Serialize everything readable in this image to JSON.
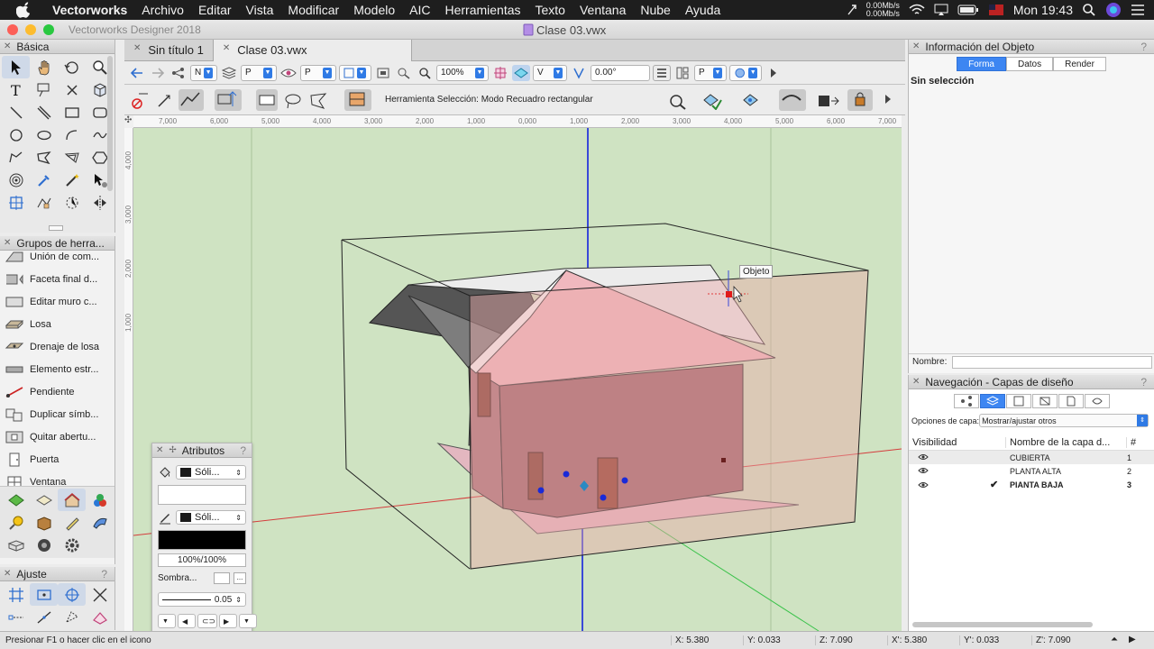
{
  "menubar": {
    "app_name": "Vectorworks",
    "items": [
      "Archivo",
      "Editar",
      "Vista",
      "Modificar",
      "Modelo",
      "AIC",
      "Herramientas",
      "Texto",
      "Ventana",
      "Nube",
      "Ayuda"
    ],
    "net_up": "0.00Mb/s",
    "net_down": "0.00Mb/s",
    "clock": "Mon 19:43"
  },
  "window": {
    "app_title": "Vectorworks Designer 2018",
    "doc_title": "Clase 03.vwx"
  },
  "tabs": [
    {
      "label": "Sin título 1",
      "active": false
    },
    {
      "label": "Clase 03.vwx",
      "active": true
    }
  ],
  "view_bar": {
    "class_select": "N",
    "layer_select": "P",
    "view_select": "P",
    "zoom": "100%",
    "render_select": "V",
    "rotation": "0.00°",
    "plane_select": "P"
  },
  "mode_bar": {
    "hint": "Herramienta Selección: Modo Recuadro rectangular"
  },
  "palettes": {
    "basic_title": "Básica",
    "groups_title": "Grupos de herra...",
    "group_items": [
      "Unión de com...",
      "Faceta final d...",
      "Editar muro c...",
      "Losa",
      "Drenaje de losa",
      "Elemento estr...",
      "Pendiente",
      "Duplicar símb...",
      "Quitar abertu...",
      "Puerta",
      "Ventana"
    ],
    "ajuste_title": "Ajuste"
  },
  "rulers": {
    "top": [
      "7,000",
      "6,000",
      "5,000",
      "4,000",
      "3,000",
      "2,000",
      "1,000",
      "0,000",
      "1,000",
      "2,000",
      "3,000",
      "4,000",
      "5,000",
      "6,000",
      "7,000"
    ],
    "left": [
      "4,000",
      "3,000",
      "2,000",
      "1,000"
    ]
  },
  "canvas": {
    "tooltip": "Objeto"
  },
  "attributes": {
    "title": "Atributos",
    "fill_label": "Sóli...",
    "pen_label": "Sóli...",
    "opacity": "100%/100%",
    "shadow_label": "Sombra...",
    "line_weight": "0.05",
    "colors": {
      "fill": "#ffffff",
      "pen": "#000000"
    }
  },
  "object_info": {
    "title": "Información del Objeto",
    "tabs": [
      {
        "label": "Forma",
        "active": true
      },
      {
        "label": "Datos",
        "active": false
      },
      {
        "label": "Render",
        "active": false
      }
    ],
    "selection": "Sin selección",
    "name_label": "Nombre:",
    "name_value": ""
  },
  "navigation": {
    "title": "Navegación - Capas de diseño",
    "options_label": "Opciones de capa:",
    "options_value": "Mostrar/ajustar otros",
    "col_visibility": "Visibilidad",
    "col_name": "Nombre de la capa d...",
    "col_num": "#",
    "layers": [
      {
        "name": "CUBIERTA",
        "num": "1",
        "active": false,
        "check": ""
      },
      {
        "name": "PLANTA ALTA",
        "num": "2",
        "active": false,
        "check": ""
      },
      {
        "name": "PIANTA BAJA",
        "num": "3",
        "active": true,
        "check": "✔"
      }
    ]
  },
  "status": {
    "help": "Presionar F1 o hacer clic en el icono",
    "x": "X: 5.380",
    "y": "Y: 0.033",
    "z": "Z: 7.090",
    "x2": "X': 5.380",
    "y2": "Y': 0.033",
    "z2": "Z': 7.090"
  }
}
